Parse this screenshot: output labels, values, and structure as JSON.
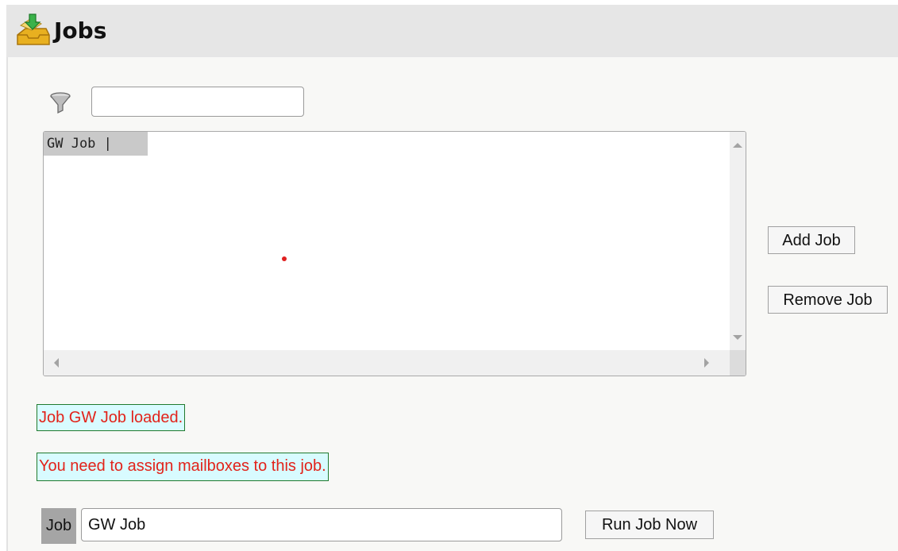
{
  "header": {
    "title": "Jobs",
    "icon": "jobs-inbox-icon"
  },
  "filter": {
    "icon": "funnel-icon",
    "value": ""
  },
  "job_list": {
    "items": [
      "GW Job |"
    ]
  },
  "buttons": {
    "add_job": "Add Job",
    "remove_job": "Remove Job",
    "run_job_now": "Run Job Now"
  },
  "messages": {
    "loaded": "Job GW Job loaded.",
    "warning": "You need to assign mailboxes to this job."
  },
  "job_field": {
    "label": "Job",
    "value": "GW Job"
  },
  "colors": {
    "message_text": "#e2231a",
    "message_bg": "#d8fbff",
    "message_border": "#1f7a2e",
    "marker_dot": "#e02020"
  }
}
